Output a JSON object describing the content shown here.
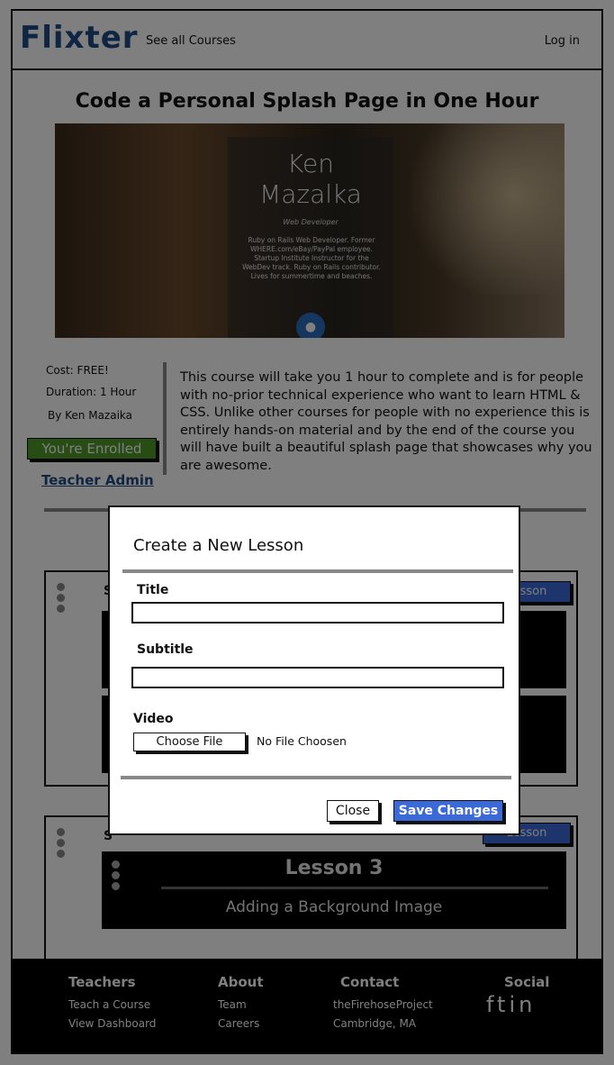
{
  "navbar": {
    "brand": "Flixter",
    "courses_link": "See all Courses",
    "login_link": "Log in"
  },
  "course": {
    "title": "Code a Personal Splash Page in One Hour",
    "hero": {
      "first_name": "Ken",
      "last_name": "Mazalka",
      "role": "Web Developer",
      "bio": "Ruby on Rails Web Developer. Former WHERE.com/eBay/PayPal employee. Startup Institute Instructor for the WebDev track. Ruby on Rails contributor. Lives for summertime and beaches.",
      "icon": "github-icon"
    },
    "cost": "Cost: FREE!",
    "duration": "Duration: 1 Hour",
    "author": "By Ken Mazaika",
    "enrolled_badge": "You're Enrolled",
    "teacher_admin": "Teacher Admin",
    "description": "This course will take you 1 hour to complete and is for people with no-prior technical experience who want to learn HTML & CSS. Unlike other courses for people with no experience this is entirely hands-on material and by the end of the course you will have built a beautiful splash page that showcases why you are awesome."
  },
  "sections": [
    {
      "title": "S",
      "add_lesson": "Lesson"
    },
    {
      "title": "S",
      "add_lesson": "Lesson"
    }
  ],
  "lesson3": {
    "title": "Lesson 3",
    "subtitle": "Adding a Background Image"
  },
  "footer": {
    "teachers": {
      "heading": "Teachers",
      "links": [
        "Teach a Course",
        "View Dashboard"
      ]
    },
    "about": {
      "heading": "About",
      "links": [
        "Team",
        "Careers"
      ]
    },
    "contact": {
      "heading": "Contact",
      "lines": [
        "theFirehoseProject",
        "Cambridge, MA"
      ]
    },
    "social": {
      "heading": "Social",
      "icons": [
        "facebook-icon",
        "twitter-icon",
        "linkedin-icon"
      ]
    }
  },
  "modal": {
    "title": "Create a New Lesson",
    "title_label": "Title",
    "title_value": "",
    "subtitle_label": "Subtitle",
    "subtitle_value": "",
    "video_label": "Video",
    "choose_file": "Choose File",
    "no_file": "No File Choosen",
    "close": "Close",
    "save": "Save Changes"
  }
}
